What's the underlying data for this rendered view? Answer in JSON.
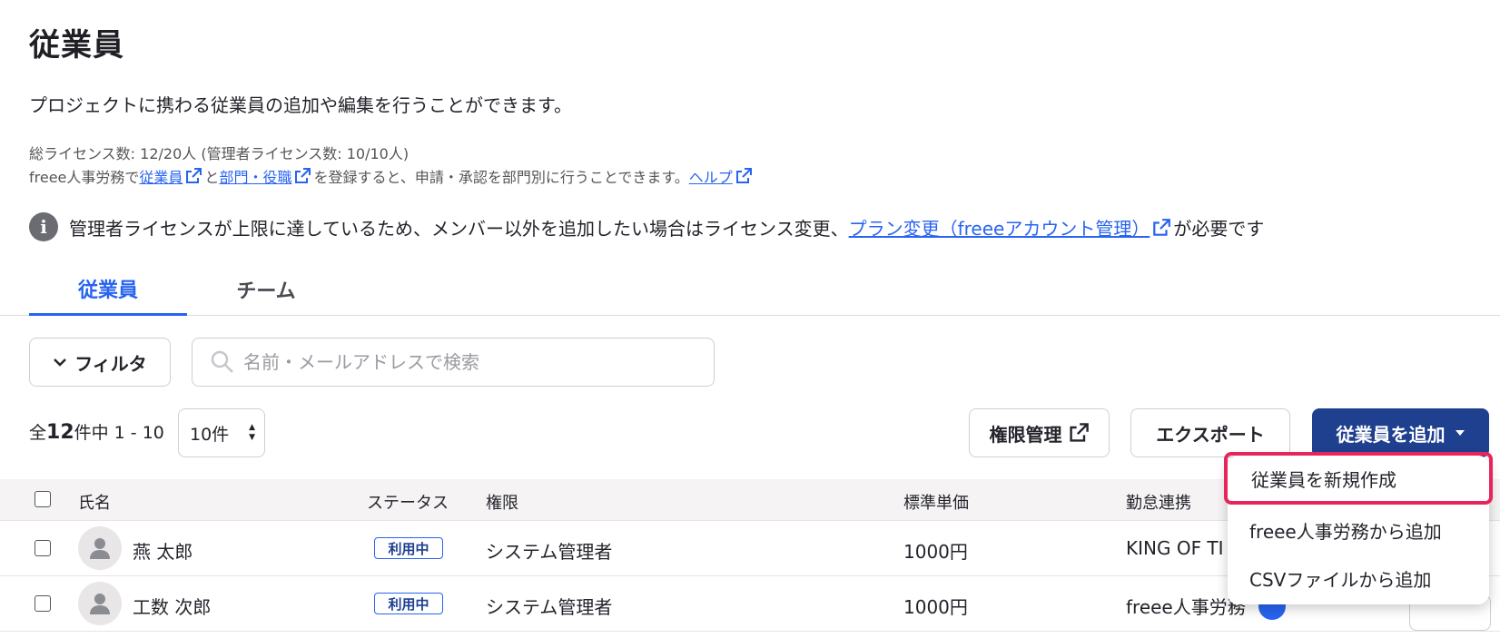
{
  "page": {
    "title": "従業員",
    "description": "プロジェクトに携わる従業員の追加や編集を行うことができます。"
  },
  "meta": {
    "license_line": "総ライセンス数: 12/20人 (管理者ライセンス数: 10/10人)",
    "hr_prefix": "freee人事労務で",
    "hr_link1": "従業員",
    "hr_and": "と",
    "hr_link2": "部門・役職",
    "hr_suffix": "を登録すると、申請・承認を部門別に行うことできます。",
    "help_link": "ヘルプ"
  },
  "notice": {
    "text_before": "管理者ライセンスが上限に達しているため、メンバー以外を追加したい場合はライセンス変更、",
    "link": "プラン変更（freeeアカウント管理）",
    "text_after": "が必要です"
  },
  "tabs": [
    {
      "label": "従業員",
      "active": true
    },
    {
      "label": "チーム",
      "active": false
    }
  ],
  "toolbar": {
    "filter_label": "フィルタ",
    "search_placeholder": "名前・メールアドレスで検索",
    "count_prefix": "全",
    "count_total": "12",
    "count_suffix": "件中 1 - 10",
    "per_page": "10件",
    "permission_label": "権限管理",
    "export_label": "エクスポート",
    "add_label": "従業員を追加"
  },
  "table": {
    "headers": [
      "氏名",
      "ステータス",
      "権限",
      "標準単価",
      "勤怠連携"
    ],
    "rows": [
      {
        "name": "燕 太郎",
        "status": "利用中",
        "role": "システム管理者",
        "rate": "1000円",
        "attendance": "KING OF TI"
      },
      {
        "name": "工数 次郎",
        "status": "利用中",
        "role": "システム管理者",
        "rate": "1000円",
        "attendance": "freee人事労務"
      }
    ]
  },
  "dropdown": {
    "items": [
      "従業員を新規作成",
      "freee人事労務から追加",
      "CSVファイルから追加"
    ]
  },
  "colors": {
    "accent": "#2864f0",
    "primary_button": "#1f3f8f",
    "highlight": "#e8245c"
  }
}
